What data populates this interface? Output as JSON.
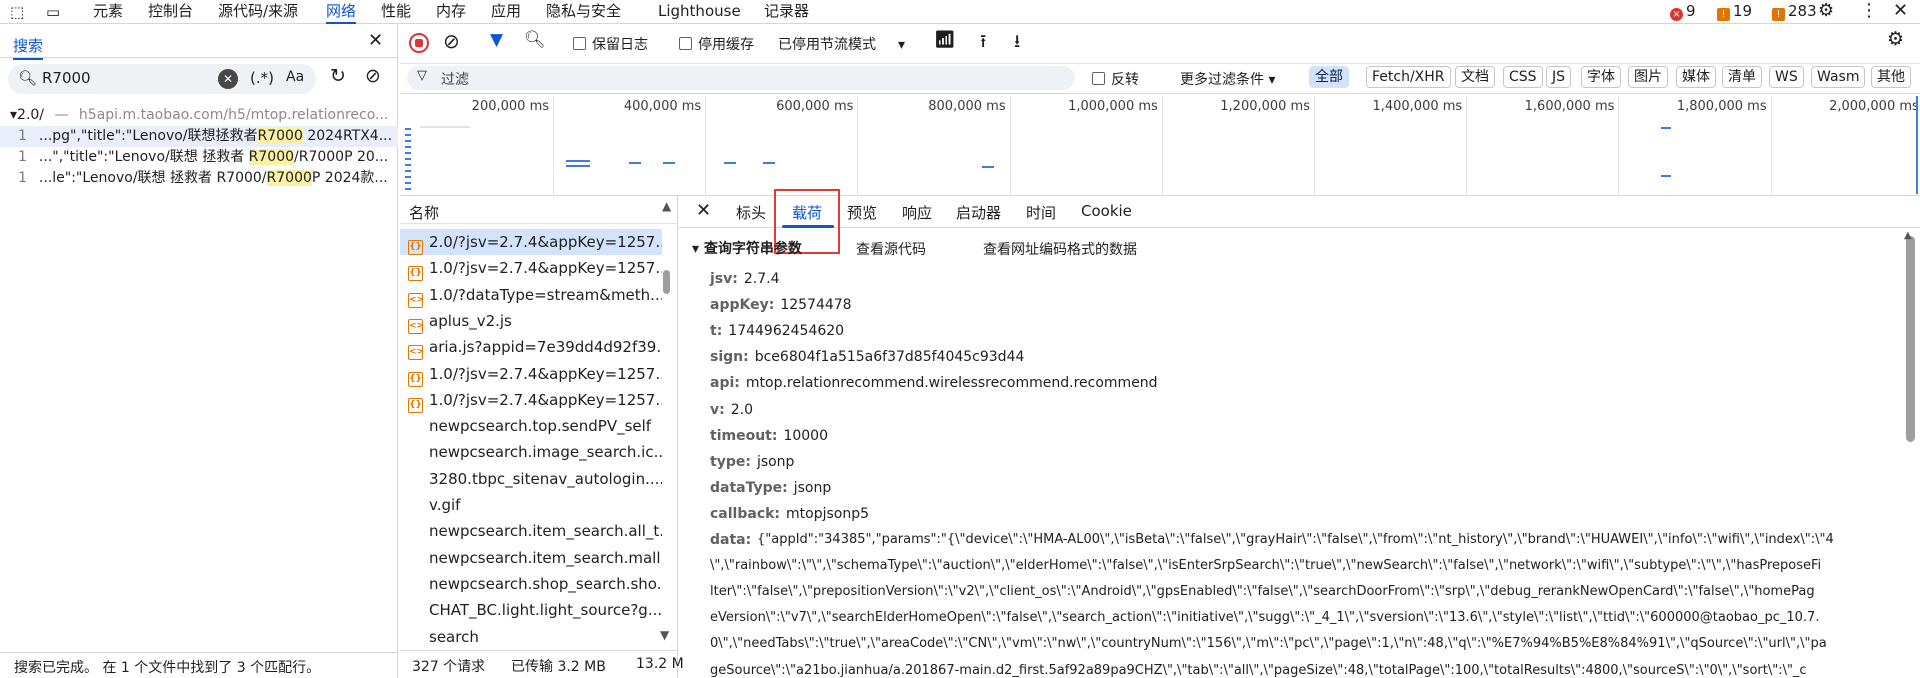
{
  "top_tabs": [
    "元素",
    "控制台",
    "源代码/来源",
    "网络",
    "性能",
    "内存",
    "应用",
    "隐私与安全",
    "Lighthouse",
    "记录器"
  ],
  "badges": {
    "errors": "9",
    "warnings": "19",
    "issues": "283"
  },
  "search_panel": {
    "title": "搜索",
    "query": "R7000",
    "regex_label": "(.*)",
    "case_label": "Aa",
    "result_file": {
      "name": "2.0/",
      "url": "h5api.m.taobao.com/h5/mtop.relationreco..."
    },
    "results": [
      {
        "line": "1",
        "pre": "...pg\",\"title\":\"Lenovo/联想拯救者",
        "match": "R7000",
        "post": " 2024RTX4..."
      },
      {
        "line": "1",
        "pre": "...\",\"title\":\"Lenovo/联想 拯救者 ",
        "match": "R7000",
        "post": "/R7000P 20..."
      },
      {
        "line": "1",
        "pre": "...le\":\"Lenovo/联想 拯救者 R7000/",
        "match": "R7000",
        "post": "P 2024款..."
      }
    ],
    "status": "搜索已完成。 在 1 个文件中找到了 3 个匹配行。"
  },
  "toolbar": {
    "preserve_log": "保留日志",
    "disable_cache": "停用缓存",
    "throttle": "已停用节流模式",
    "filter_placeholder": "过滤",
    "invert": "反转",
    "more_filters": "更多过滤条件",
    "filter_types": [
      "全部",
      "Fetch/XHR",
      "文档",
      "CSS",
      "JS",
      "字体",
      "图片",
      "媒体",
      "清单",
      "WS",
      "Wasm",
      "其他"
    ]
  },
  "timeline_ticks": [
    "200,000 ms",
    "400,000 ms",
    "600,000 ms",
    "800,000 ms",
    "1,000,000 ms",
    "1,200,000 ms",
    "1,400,000 ms",
    "1,600,000 ms",
    "1,800,000 ms",
    "2,000,000 ms"
  ],
  "request_list": {
    "header": "名称",
    "rows": [
      {
        "icon": "xhr-icon",
        "name": "2.0/?jsv=2.7.4&appKey=1257..."
      },
      {
        "icon": "xhr-icon",
        "name": "1.0/?jsv=2.7.4&appKey=1257..."
      },
      {
        "icon": "script-icon",
        "name": "1.0/?dataType=stream&meth..."
      },
      {
        "icon": "script-icon",
        "name": "aplus_v2.js"
      },
      {
        "icon": "script-icon",
        "name": "aria.js?appid=7e39dd4d92f39..."
      },
      {
        "icon": "xhr-icon",
        "name": "1.0/?jsv=2.7.4&appKey=1257..."
      },
      {
        "icon": "xhr-icon",
        "name": "1.0/?jsv=2.7.4&appKey=1257..."
      },
      {
        "icon": "",
        "name": "newpcsearch.top.sendPV_self"
      },
      {
        "icon": "",
        "name": "newpcsearch.image_search.ic..."
      },
      {
        "icon": "",
        "name": "3280.tbpc_sitenav_autologin...."
      },
      {
        "icon": "",
        "name": "v.gif"
      },
      {
        "icon": "",
        "name": "newpcsearch.item_search.all_t..."
      },
      {
        "icon": "",
        "name": "newpcsearch.item_search.mall..."
      },
      {
        "icon": "",
        "name": "newpcsearch.shop_search.sho..."
      },
      {
        "icon": "",
        "name": "CHAT_BC.light.light_source?g..."
      },
      {
        "icon": "",
        "name": "search"
      }
    ]
  },
  "status_bar": {
    "requests": "327 个请求",
    "transferred": "已传输 3.2 MB",
    "resources": "13.2 M"
  },
  "detail_tabs": [
    "标头",
    "载荷",
    "预览",
    "响应",
    "启动器",
    "时间",
    "Cookie"
  ],
  "payload": {
    "section_title": "查询字符串参数",
    "view_source": "查看源代码",
    "view_url_encoded": "查看网址编码格式的数据",
    "params": [
      {
        "k": "jsv:",
        "v": "2.7.4"
      },
      {
        "k": "appKey:",
        "v": "12574478"
      },
      {
        "k": "t:",
        "v": "1744962454620"
      },
      {
        "k": "sign:",
        "v": "bce6804f1a515a6f37d85f4045c93d44"
      },
      {
        "k": "api:",
        "v": "mtop.relationrecommend.wirelessrecommend.recommend"
      },
      {
        "k": "v:",
        "v": "2.0"
      },
      {
        "k": "timeout:",
        "v": "10000"
      },
      {
        "k": "type:",
        "v": "jsonp"
      },
      {
        "k": "dataType:",
        "v": "jsonp"
      },
      {
        "k": "callback:",
        "v": "mtopjsonp5"
      }
    ],
    "data_key": "data:",
    "data_lines": [
      "{\"appId\":\"34385\",\"params\":\"{\\\"device\\\":\\\"HMA-AL00\\\",\\\"isBeta\\\":\\\"false\\\",\\\"grayHair\\\":\\\"false\\\",\\\"from\\\":\\\"nt_history\\\",\\\"brand\\\":\\\"HUAWEI\\\",\\\"info\\\":\\\"wifi\\\",\\\"index\\\":\\\"4",
      "\\\",\\\"rainbow\\\":\\\"\\\",\\\"schemaType\\\":\\\"auction\\\",\\\"elderHome\\\":\\\"false\\\",\\\"isEnterSrpSearch\\\":\\\"true\\\",\\\"newSearch\\\":\\\"false\\\",\\\"network\\\":\\\"wifi\\\",\\\"subtype\\\":\\\"\\\",\\\"hasPreposeFi",
      "lter\\\":\\\"false\\\",\\\"prepositionVersion\\\":\\\"v2\\\",\\\"client_os\\\":\\\"Android\\\",\\\"gpsEnabled\\\":\\\"false\\\",\\\"searchDoorFrom\\\":\\\"srp\\\",\\\"debug_rerankNewOpenCard\\\":\\\"false\\\",\\\"homePag",
      "eVersion\\\":\\\"v7\\\",\\\"searchElderHomeOpen\\\":\\\"false\\\",\\\"search_action\\\":\\\"initiative\\\",\\\"sugg\\\":\\\"_4_1\\\",\\\"sversion\\\":\\\"13.6\\\",\\\"style\\\":\\\"list\\\",\\\"ttid\\\":\\\"600000@taobao_pc_10.7.",
      "0\\\",\\\"needTabs\\\":\\\"true\\\",\\\"areaCode\\\":\\\"CN\\\",\\\"vm\\\":\\\"nw\\\",\\\"countryNum\\\":\\\"156\\\",\\\"m\\\":\\\"pc\\\",\\\"page\\\":1,\\\"n\\\":48,\\\"q\\\":\\\"%E7%94%B5%E8%84%91\\\",\\\"qSource\\\":\\\"url\\\",\\\"pa",
      "geSource\\\":\\\"a21bo.jianhua/a.201867-main.d2_first.5af92a89pa9CHZ\\\",\\\"tab\\\":\\\"all\\\",\\\"pageSize\\\":48,\\\"totalPage\\\":100,\\\"totalResults\\\":4800,\\\"sourceS\\\":\\\"0\\\",\\\"sort\\\":\\\"_c"
    ]
  }
}
